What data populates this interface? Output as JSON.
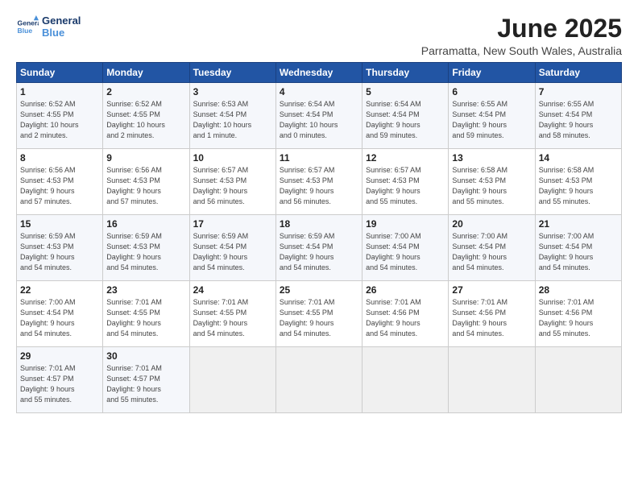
{
  "header": {
    "logo_line1": "General",
    "logo_line2": "Blue",
    "title": "June 2025",
    "subtitle": "Parramatta, New South Wales, Australia"
  },
  "days_of_week": [
    "Sunday",
    "Monday",
    "Tuesday",
    "Wednesday",
    "Thursday",
    "Friday",
    "Saturday"
  ],
  "weeks": [
    [
      {
        "num": "1",
        "detail": "Sunrise: 6:52 AM\nSunset: 4:55 PM\nDaylight: 10 hours\nand 2 minutes."
      },
      {
        "num": "2",
        "detail": "Sunrise: 6:52 AM\nSunset: 4:55 PM\nDaylight: 10 hours\nand 2 minutes."
      },
      {
        "num": "3",
        "detail": "Sunrise: 6:53 AM\nSunset: 4:54 PM\nDaylight: 10 hours\nand 1 minute."
      },
      {
        "num": "4",
        "detail": "Sunrise: 6:54 AM\nSunset: 4:54 PM\nDaylight: 10 hours\nand 0 minutes."
      },
      {
        "num": "5",
        "detail": "Sunrise: 6:54 AM\nSunset: 4:54 PM\nDaylight: 9 hours\nand 59 minutes."
      },
      {
        "num": "6",
        "detail": "Sunrise: 6:55 AM\nSunset: 4:54 PM\nDaylight: 9 hours\nand 59 minutes."
      },
      {
        "num": "7",
        "detail": "Sunrise: 6:55 AM\nSunset: 4:54 PM\nDaylight: 9 hours\nand 58 minutes."
      }
    ],
    [
      {
        "num": "8",
        "detail": "Sunrise: 6:56 AM\nSunset: 4:53 PM\nDaylight: 9 hours\nand 57 minutes."
      },
      {
        "num": "9",
        "detail": "Sunrise: 6:56 AM\nSunset: 4:53 PM\nDaylight: 9 hours\nand 57 minutes."
      },
      {
        "num": "10",
        "detail": "Sunrise: 6:57 AM\nSunset: 4:53 PM\nDaylight: 9 hours\nand 56 minutes."
      },
      {
        "num": "11",
        "detail": "Sunrise: 6:57 AM\nSunset: 4:53 PM\nDaylight: 9 hours\nand 56 minutes."
      },
      {
        "num": "12",
        "detail": "Sunrise: 6:57 AM\nSunset: 4:53 PM\nDaylight: 9 hours\nand 55 minutes."
      },
      {
        "num": "13",
        "detail": "Sunrise: 6:58 AM\nSunset: 4:53 PM\nDaylight: 9 hours\nand 55 minutes."
      },
      {
        "num": "14",
        "detail": "Sunrise: 6:58 AM\nSunset: 4:53 PM\nDaylight: 9 hours\nand 55 minutes."
      }
    ],
    [
      {
        "num": "15",
        "detail": "Sunrise: 6:59 AM\nSunset: 4:53 PM\nDaylight: 9 hours\nand 54 minutes."
      },
      {
        "num": "16",
        "detail": "Sunrise: 6:59 AM\nSunset: 4:53 PM\nDaylight: 9 hours\nand 54 minutes."
      },
      {
        "num": "17",
        "detail": "Sunrise: 6:59 AM\nSunset: 4:54 PM\nDaylight: 9 hours\nand 54 minutes."
      },
      {
        "num": "18",
        "detail": "Sunrise: 6:59 AM\nSunset: 4:54 PM\nDaylight: 9 hours\nand 54 minutes."
      },
      {
        "num": "19",
        "detail": "Sunrise: 7:00 AM\nSunset: 4:54 PM\nDaylight: 9 hours\nand 54 minutes."
      },
      {
        "num": "20",
        "detail": "Sunrise: 7:00 AM\nSunset: 4:54 PM\nDaylight: 9 hours\nand 54 minutes."
      },
      {
        "num": "21",
        "detail": "Sunrise: 7:00 AM\nSunset: 4:54 PM\nDaylight: 9 hours\nand 54 minutes."
      }
    ],
    [
      {
        "num": "22",
        "detail": "Sunrise: 7:00 AM\nSunset: 4:54 PM\nDaylight: 9 hours\nand 54 minutes."
      },
      {
        "num": "23",
        "detail": "Sunrise: 7:01 AM\nSunset: 4:55 PM\nDaylight: 9 hours\nand 54 minutes."
      },
      {
        "num": "24",
        "detail": "Sunrise: 7:01 AM\nSunset: 4:55 PM\nDaylight: 9 hours\nand 54 minutes."
      },
      {
        "num": "25",
        "detail": "Sunrise: 7:01 AM\nSunset: 4:55 PM\nDaylight: 9 hours\nand 54 minutes."
      },
      {
        "num": "26",
        "detail": "Sunrise: 7:01 AM\nSunset: 4:56 PM\nDaylight: 9 hours\nand 54 minutes."
      },
      {
        "num": "27",
        "detail": "Sunrise: 7:01 AM\nSunset: 4:56 PM\nDaylight: 9 hours\nand 54 minutes."
      },
      {
        "num": "28",
        "detail": "Sunrise: 7:01 AM\nSunset: 4:56 PM\nDaylight: 9 hours\nand 55 minutes."
      }
    ],
    [
      {
        "num": "29",
        "detail": "Sunrise: 7:01 AM\nSunset: 4:57 PM\nDaylight: 9 hours\nand 55 minutes."
      },
      {
        "num": "30",
        "detail": "Sunrise: 7:01 AM\nSunset: 4:57 PM\nDaylight: 9 hours\nand 55 minutes."
      },
      {
        "num": "",
        "detail": ""
      },
      {
        "num": "",
        "detail": ""
      },
      {
        "num": "",
        "detail": ""
      },
      {
        "num": "",
        "detail": ""
      },
      {
        "num": "",
        "detail": ""
      }
    ]
  ]
}
